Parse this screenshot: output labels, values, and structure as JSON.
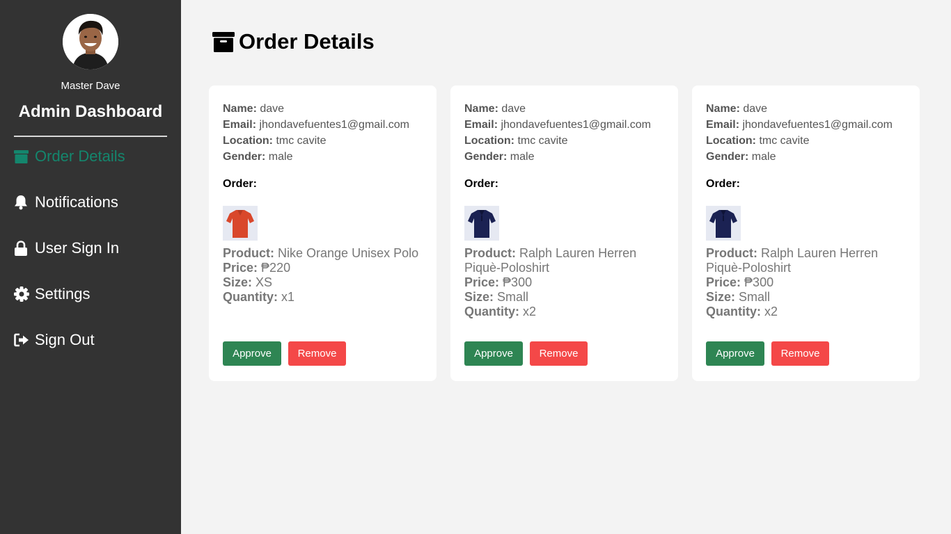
{
  "sidebar": {
    "admin_name": "Master Dave",
    "title": "Admin Dashboard",
    "accent_color": "#14866d",
    "items": [
      {
        "label": "Order Details",
        "icon": "archive-icon",
        "active": true
      },
      {
        "label": "Notifications",
        "icon": "bell-icon",
        "active": false
      },
      {
        "label": "User Sign In",
        "icon": "lock-icon",
        "active": false
      },
      {
        "label": "Settings",
        "icon": "gear-icon",
        "active": false
      },
      {
        "label": "Sign Out",
        "icon": "sign-out-icon",
        "active": false
      }
    ]
  },
  "main": {
    "title": "Order Details",
    "title_icon": "archive-icon"
  },
  "labels": {
    "name": "Name:",
    "email": "Email:",
    "location": "Location:",
    "gender": "Gender:",
    "order": "Order:",
    "product": "Product:",
    "price": "Price:",
    "size": "Size:",
    "quantity": "Quantity:",
    "approve": "Approve",
    "remove": "Remove"
  },
  "orders": [
    {
      "name": "dave",
      "email": "jhondavefuentes1@gmail.com",
      "location": "tmc cavite",
      "gender": "male",
      "product": "Nike Orange Unisex Polo",
      "product_color": "#d9472b",
      "price": "₱220",
      "size": "XS",
      "quantity": "x1"
    },
    {
      "name": "dave",
      "email": "jhondavefuentes1@gmail.com",
      "location": "tmc cavite",
      "gender": "male",
      "product": "Ralph Lauren Herren Piquè-Poloshirt",
      "product_color": "#1b2253",
      "price": "₱300",
      "size": "Small",
      "quantity": "x2"
    },
    {
      "name": "dave",
      "email": "jhondavefuentes1@gmail.com",
      "location": "tmc cavite",
      "gender": "male",
      "product": "Ralph Lauren Herren Piquè-Poloshirt",
      "product_color": "#1b2253",
      "price": "₱300",
      "size": "Small",
      "quantity": "x2"
    }
  ],
  "colors": {
    "approve": "#2e8553",
    "remove": "#f44848",
    "sidebar_bg": "#333333"
  }
}
